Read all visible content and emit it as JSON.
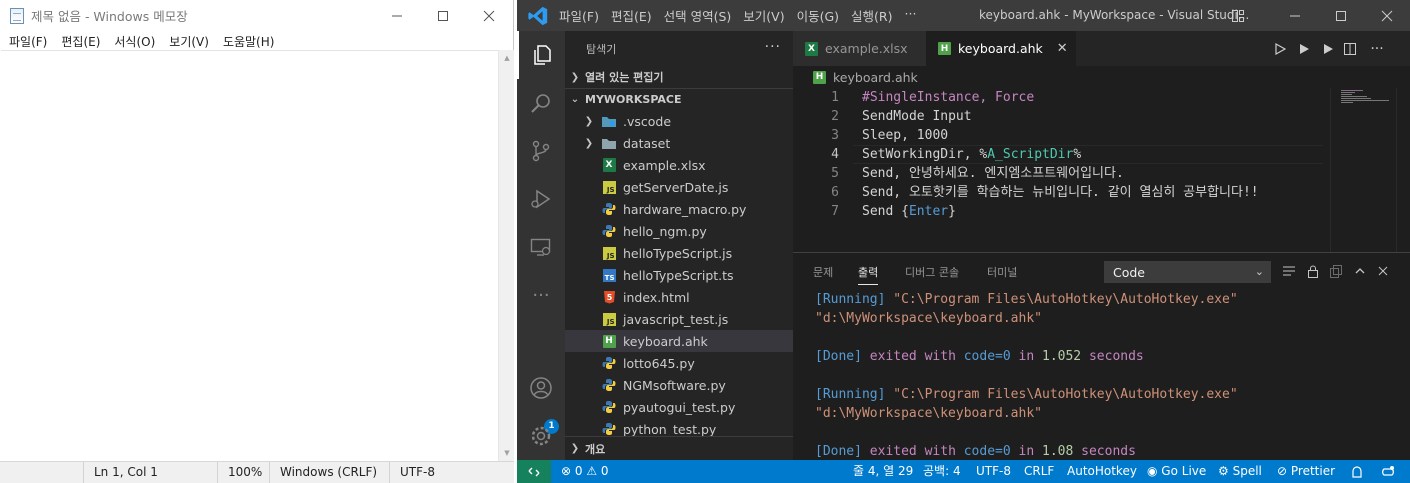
{
  "notepad": {
    "title": "제목 없음 - Windows 메모장",
    "menu": [
      "파일(F)",
      "편집(E)",
      "서식(O)",
      "보기(V)",
      "도움말(H)"
    ],
    "status": {
      "position": "Ln 1, Col 1",
      "zoom": "100%",
      "line_ending": "Windows (CRLF)",
      "encoding": "UTF-8"
    }
  },
  "vscode": {
    "title": "keyboard.ahk - MyWorkspace - Visual Studi...",
    "menu": [
      "파일(F)",
      "편집(E)",
      "선택 영역(S)",
      "보기(V)",
      "이동(G)",
      "실행(R)",
      "···"
    ],
    "sidebar": {
      "header": "탐색기",
      "open_editors": "열려 있는 편집기",
      "workspace": "MYWORKSPACE",
      "outline": "개요",
      "items": [
        {
          "name": ".vscode",
          "type": "folder-vscode"
        },
        {
          "name": "dataset",
          "type": "folder"
        },
        {
          "name": "example.xlsx",
          "type": "xlsx"
        },
        {
          "name": "getServerDate.js",
          "type": "js"
        },
        {
          "name": "hardware_macro.py",
          "type": "py"
        },
        {
          "name": "hello_ngm.py",
          "type": "py"
        },
        {
          "name": "helloTypeScript.js",
          "type": "js"
        },
        {
          "name": "helloTypeScript.ts",
          "type": "ts"
        },
        {
          "name": "index.html",
          "type": "html"
        },
        {
          "name": "javascript_test.js",
          "type": "js"
        },
        {
          "name": "keyboard.ahk",
          "type": "ahk"
        },
        {
          "name": "lotto645.py",
          "type": "py"
        },
        {
          "name": "NGMsoftware.py",
          "type": "py"
        },
        {
          "name": "pyautogui_test.py",
          "type": "py"
        },
        {
          "name": "python_test.py",
          "type": "py"
        }
      ],
      "selected": "keyboard.ahk"
    },
    "tabs": [
      {
        "label": "example.xlsx",
        "active": false
      },
      {
        "label": "keyboard.ahk",
        "active": true
      }
    ],
    "breadcrumb": "keyboard.ahk",
    "editor": {
      "current_line": 4,
      "lines": [
        {
          "no": "1",
          "parts": [
            {
              "t": "#SingleInstance, Force",
              "c": "c-kw"
            }
          ]
        },
        {
          "no": "2",
          "parts": [
            {
              "t": "SendMode Input",
              "c": "c-txt"
            }
          ]
        },
        {
          "no": "3",
          "parts": [
            {
              "t": "Sleep, 1000",
              "c": "c-txt"
            }
          ]
        },
        {
          "no": "4",
          "parts": [
            {
              "t": "SetWorkingDir, %",
              "c": "c-txt"
            },
            {
              "t": "A_ScriptDir",
              "c": "c-var"
            },
            {
              "t": "%",
              "c": "c-txt"
            }
          ]
        },
        {
          "no": "5",
          "parts": [
            {
              "t": "Send, 안녕하세요. 엔지엠소프트웨어입니다.",
              "c": "c-txt"
            }
          ]
        },
        {
          "no": "6",
          "parts": [
            {
              "t": "Send, 오토핫키를 학습하는 뉴비입니다. 같이 열심히 공부합니다!!",
              "c": "c-txt"
            }
          ]
        },
        {
          "no": "7",
          "parts": [
            {
              "t": "Send {",
              "c": "c-txt"
            },
            {
              "t": "Enter",
              "c": "c-blue"
            },
            {
              "t": "}",
              "c": "c-txt"
            }
          ]
        }
      ]
    },
    "panel": {
      "tabs": [
        "문제",
        "출력",
        "디버그 콘솔",
        "터미널"
      ],
      "active_tab": "출력",
      "channel": "Code",
      "output": [
        [
          {
            "t": "[Running] ",
            "c": "c-blue"
          },
          {
            "t": "\"C:\\Program Files\\AutoHotkey\\AutoHotkey.exe\"",
            "c": "c-str"
          }
        ],
        [
          {
            "t": "\"d:\\MyWorkspace\\keyboard.ahk\"",
            "c": "c-str"
          }
        ],
        [
          {
            "t": "",
            "c": "c-txt"
          }
        ],
        [
          {
            "t": "[Done] ",
            "c": "c-blue"
          },
          {
            "t": "exited with ",
            "c": "c-kw"
          },
          {
            "t": "code=0",
            "c": "c-blue"
          },
          {
            "t": " in ",
            "c": "c-kw"
          },
          {
            "t": "1.052",
            "c": "c-grn"
          },
          {
            "t": " seconds",
            "c": "c-kw"
          }
        ],
        [
          {
            "t": "",
            "c": "c-txt"
          }
        ],
        [
          {
            "t": "[Running] ",
            "c": "c-blue"
          },
          {
            "t": "\"C:\\Program Files\\AutoHotkey\\AutoHotkey.exe\"",
            "c": "c-str"
          }
        ],
        [
          {
            "t": "\"d:\\MyWorkspace\\keyboard.ahk\"",
            "c": "c-str"
          }
        ],
        [
          {
            "t": "",
            "c": "c-txt"
          }
        ],
        [
          {
            "t": "[Done] ",
            "c": "c-blue"
          },
          {
            "t": "exited with ",
            "c": "c-kw"
          },
          {
            "t": "code=0",
            "c": "c-blue"
          },
          {
            "t": " in ",
            "c": "c-kw"
          },
          {
            "t": "1.08",
            "c": "c-grn"
          },
          {
            "t": " seconds",
            "c": "c-kw"
          }
        ]
      ]
    },
    "status": {
      "problems": "⊗ 0 ⚠ 0",
      "position": "줄 4, 열 29",
      "spaces": "공백: 4",
      "encoding": "UTF-8",
      "eol": "CRLF",
      "language": "AutoHotkey",
      "golive": "Go Live",
      "spell": "Spell",
      "prettier": "Prettier"
    },
    "account_badge": "1",
    "colors": {
      "status_bar": "#007acc",
      "remote": "#16825d",
      "activity_bar": "#333333",
      "sidebar": "#252526",
      "editor": "#1e1e1e"
    }
  }
}
